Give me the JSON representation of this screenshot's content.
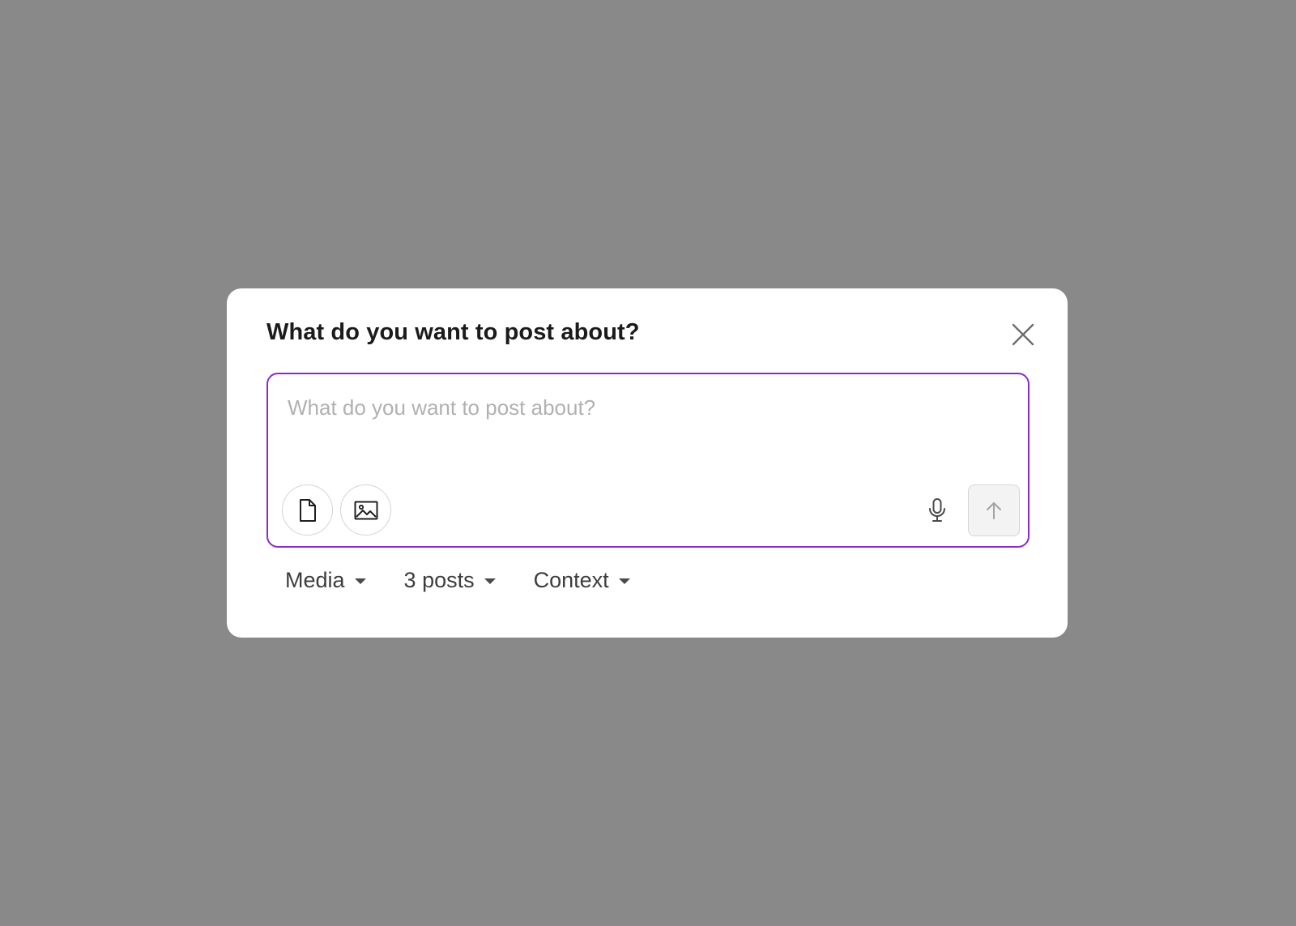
{
  "dialog": {
    "title": "What do you want to post about?",
    "close_icon": "close-icon"
  },
  "composer": {
    "value": "",
    "placeholder": "What do you want to post about?",
    "focus_border_color": "#8a2bc9",
    "attach_file_icon": "document-icon",
    "attach_image_icon": "image-icon",
    "mic_icon": "microphone-icon",
    "send_icon": "arrow-up-icon",
    "send_enabled": false
  },
  "options": {
    "media_label": "Media",
    "posts_label": "3 posts",
    "context_label": "Context",
    "dropdown_icon": "caret-down-icon"
  },
  "colors": {
    "backdrop": "#898989",
    "dialog_background": "#ffffff",
    "title_text": "#1b1b1b",
    "placeholder_text": "#b1b1b1",
    "option_text": "#3d3d3d"
  }
}
